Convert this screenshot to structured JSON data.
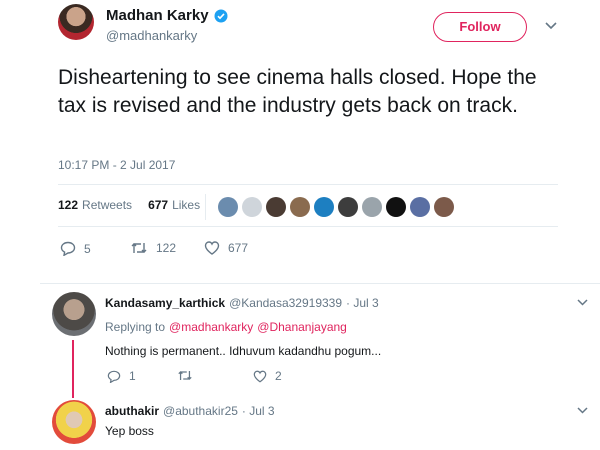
{
  "tweet": {
    "author_name": "Madhan Karky",
    "author_handle": "@madhankarky",
    "follow_label": "Follow",
    "text": "Disheartening to see cinema halls closed. Hope the tax is revised and the industry gets back on track.",
    "timestamp": "10:17 PM - 2 Jul 2017",
    "retweets_count": "122",
    "retweets_label": "Retweets",
    "likes_count": "677",
    "likes_label": "Likes",
    "actions": {
      "replies": "5",
      "retweets": "122",
      "likes": "677"
    }
  },
  "replies": [
    {
      "name": "Kandasamy_karthick",
      "handle": "@Kandasa32919339",
      "date": "· Jul 3",
      "replying_prefix": "Replying to",
      "replying_to_1": "@madhankarky",
      "replying_to_2": "@Dhananjayang",
      "text": "Nothing is permanent.. Idhuvum kadandhu pogum...",
      "actions": {
        "replies": "1",
        "retweets": "",
        "likes": "2"
      }
    },
    {
      "name": "abuthakir",
      "handle": "@abuthakir25",
      "date": "· Jul 3",
      "text": "Yep boss"
    }
  ],
  "colors": {
    "accent": "#e0245e",
    "verified": "#1da1f2",
    "muted": "#657786",
    "divider": "#e6ecf0"
  },
  "icons": [
    "verified-icon",
    "chevron-down-icon",
    "reply-icon",
    "retweet-icon",
    "heart-icon"
  ]
}
